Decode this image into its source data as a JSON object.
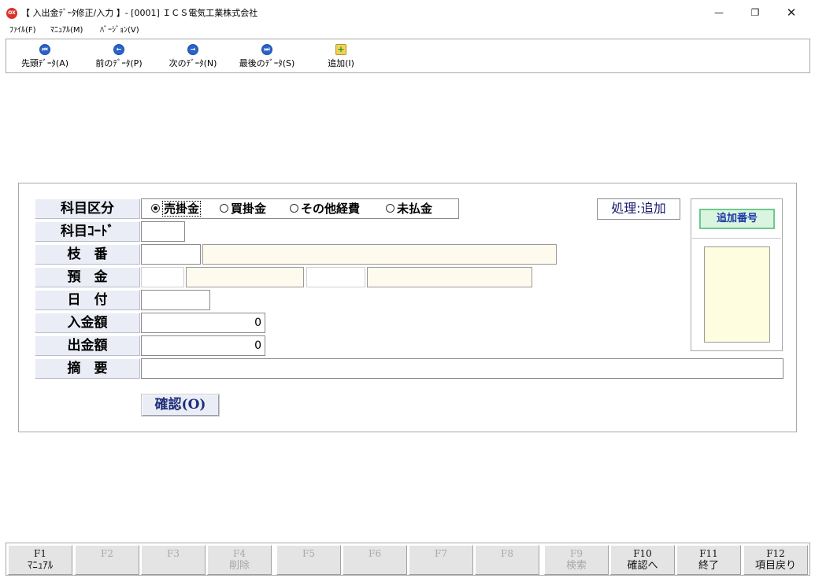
{
  "window": {
    "title": "【 入出金ﾃﾞｰﾀ修正/入力 】- [0001] ＩＣＳ電気工業株式会社",
    "app_icon_text": "OX",
    "minimize_glyph": "—",
    "maximize_glyph": "❐",
    "close_glyph": "✕"
  },
  "menu": [
    {
      "label": "ﾌｧｲﾙ(F)"
    },
    {
      "label": "ﾏﾆｭｱﾙ(M)"
    },
    {
      "label": "ﾊﾞｰｼﾞｮﾝ(V)"
    }
  ],
  "toolbar": [
    {
      "label": "先頭ﾃﾞｰﾀ(A)",
      "icon": "first-icon",
      "glyph": "⏮"
    },
    {
      "label": "前のﾃﾞｰﾀ(P)",
      "icon": "prev-icon",
      "glyph": "←"
    },
    {
      "label": "次のﾃﾞｰﾀ(N)",
      "icon": "next-icon",
      "glyph": "→"
    },
    {
      "label": "最後のﾃﾞｰﾀ(S)",
      "icon": "last-icon",
      "glyph": "⏭"
    },
    {
      "label": "追加(I)",
      "icon": "add-icon",
      "glyph": "+"
    }
  ],
  "form": {
    "labels": {
      "category": "科目区分",
      "account_code": "科目ｺｰﾄﾞ",
      "branch": "枝　番",
      "deposit": "預　金",
      "date": "日　付",
      "income": "入金額",
      "expense": "出金額",
      "memo": "摘　要"
    },
    "radios": [
      {
        "label": "売掛金",
        "selected": true
      },
      {
        "label": "買掛金",
        "selected": false
      },
      {
        "label": "その他経費",
        "selected": false
      },
      {
        "label": "未払金",
        "selected": false
      }
    ],
    "mode": "処理:追加",
    "income_value": "0",
    "expense_value": "0",
    "account_code_value": "",
    "branch_value": "",
    "branch_name_value": "",
    "deposit_value": "",
    "deposit_name_value": "",
    "deposit_sub_value": "",
    "deposit_sub_name_value": "",
    "date_value": "",
    "memo_value": "",
    "confirm_button": "確認(O)"
  },
  "side": {
    "header": "追加番号"
  },
  "fkeys": [
    {
      "key": "F1",
      "label": "ﾏﾆｭｱﾙ",
      "enabled": true
    },
    {
      "key": "F2",
      "label": "",
      "enabled": false
    },
    {
      "key": "F3",
      "label": "",
      "enabled": false
    },
    {
      "key": "F4",
      "label": "削除",
      "enabled": false
    },
    {
      "key": "F5",
      "label": "",
      "enabled": false
    },
    {
      "key": "F6",
      "label": "",
      "enabled": false
    },
    {
      "key": "F7",
      "label": "",
      "enabled": false
    },
    {
      "key": "F8",
      "label": "",
      "enabled": false
    },
    {
      "key": "F9",
      "label": "検索",
      "enabled": false
    },
    {
      "key": "F10",
      "label": "確認へ",
      "enabled": true
    },
    {
      "key": "F11",
      "label": "終了",
      "enabled": true
    },
    {
      "key": "F12",
      "label": "項目戻り",
      "enabled": true
    }
  ]
}
